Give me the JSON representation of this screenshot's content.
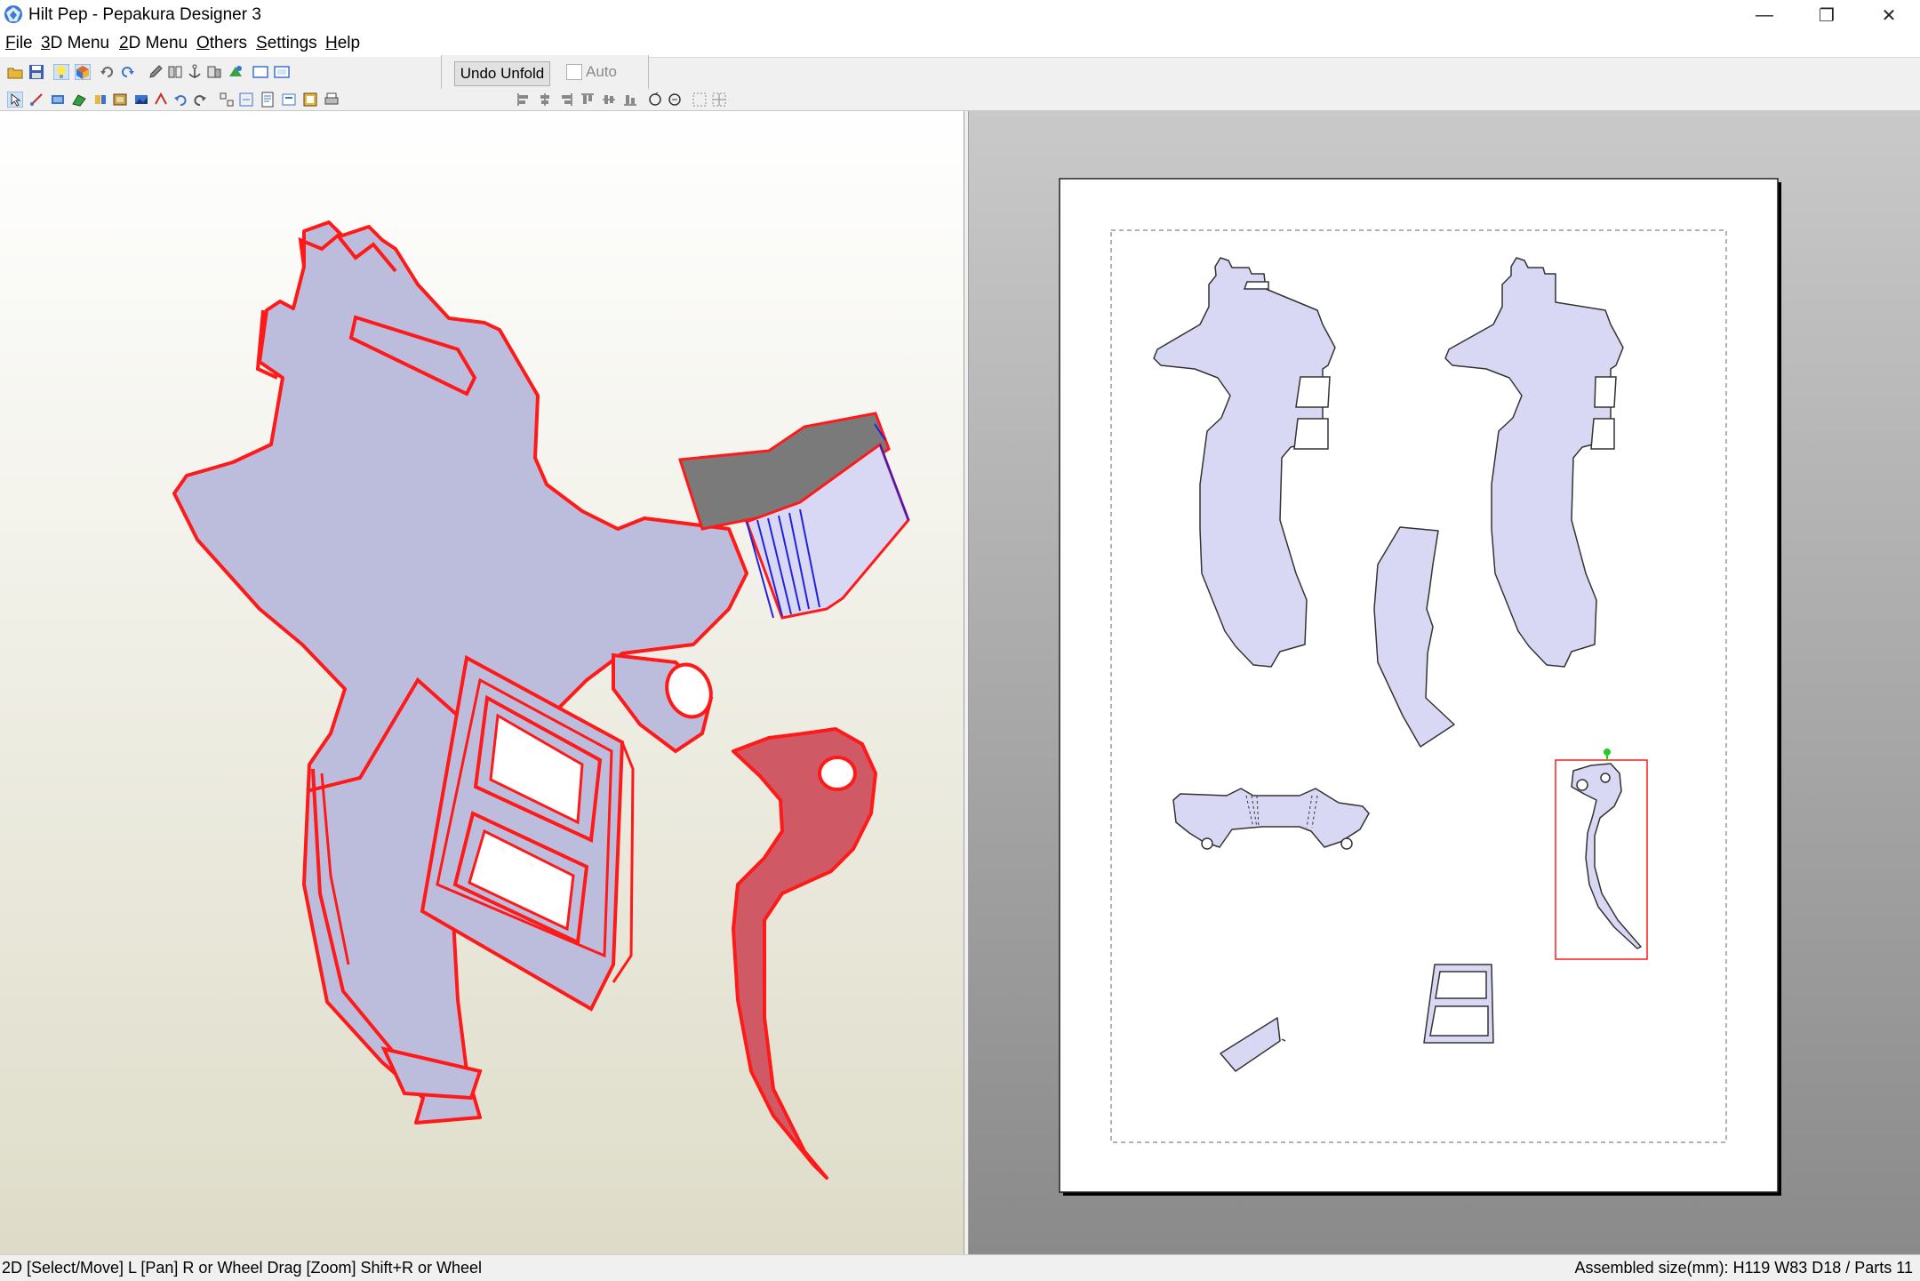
{
  "window": {
    "title": "Hilt Pep - Pepakura Designer 3",
    "minimize_label": "—",
    "restore_label": "❐",
    "close_label": "✕"
  },
  "menu": {
    "items": [
      {
        "accel": "F",
        "rest": "ile"
      },
      {
        "accel": "3",
        "rest": "D Menu"
      },
      {
        "accel": "2",
        "rest": "D Menu"
      },
      {
        "accel": "O",
        "rest": "thers"
      },
      {
        "accel": "S",
        "rest": "ettings"
      },
      {
        "accel": "H",
        "rest": "elp"
      }
    ]
  },
  "unfold": {
    "undo_label": "Undo Unfold",
    "auto_label": "Auto",
    "auto_checked": false
  },
  "status": {
    "left": "2D [Select/Move] L [Pan] R or Wheel Drag [Zoom] Shift+R or Wheel",
    "right": "Assembled size(mm): H119 W83 D18 / Parts 11"
  },
  "colors": {
    "part_fill": "#bcbcdc",
    "part_fill_2d": "#d8d8f4",
    "selected_edge": "#ff1a1a",
    "selected_part": "#cf5a66",
    "dark_face": "#7a7a7a"
  }
}
